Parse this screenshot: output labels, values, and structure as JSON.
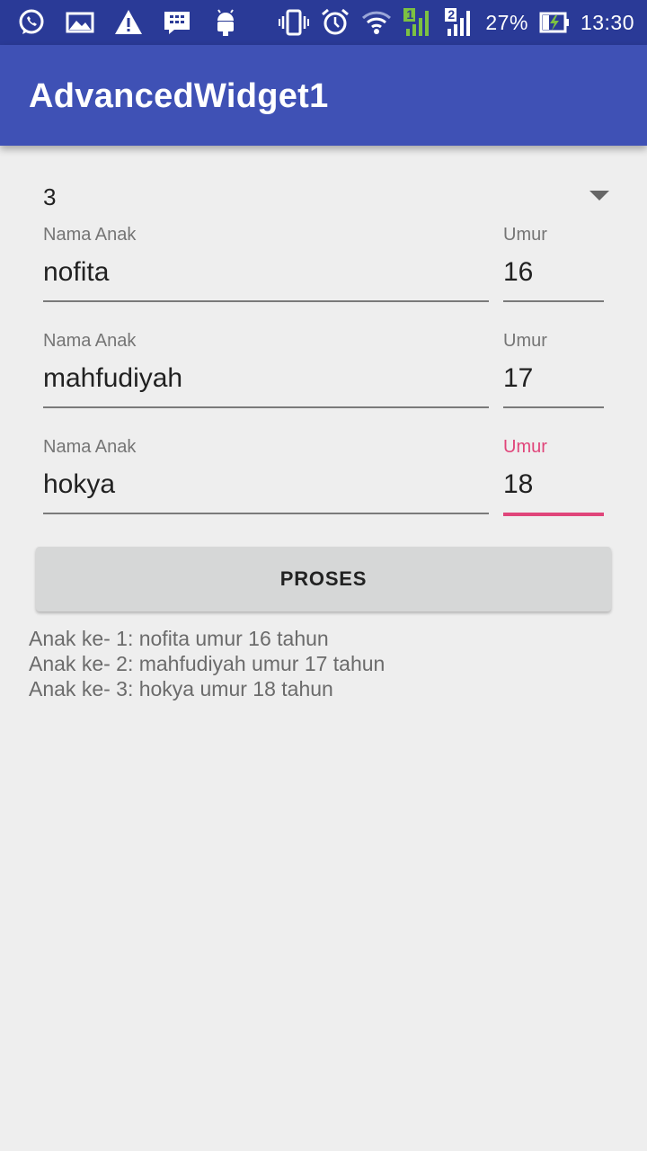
{
  "status_bar": {
    "battery_percent": "27%",
    "time": "13:30",
    "sim1_label": "1",
    "sim2_label": "2",
    "icons_left": [
      "whatsapp-icon",
      "gallery-icon",
      "warning-icon",
      "bbm-icon",
      "android-icon"
    ],
    "icons_right": [
      "vibrate-icon",
      "alarm-icon",
      "wifi-icon",
      "signal-sim1-icon",
      "signal-sim2-icon",
      "battery-charging-icon"
    ]
  },
  "app_bar": {
    "title": "AdvancedWidget1"
  },
  "spinner": {
    "selected": "3"
  },
  "rows": [
    {
      "name_label": "Nama Anak",
      "name_value": "nofita",
      "age_label": "Umur",
      "age_value": "16"
    },
    {
      "name_label": "Nama Anak",
      "name_value": "mahfudiyah",
      "age_label": "Umur",
      "age_value": "17"
    },
    {
      "name_label": "Nama Anak",
      "name_value": "hokya",
      "age_label": "Umur",
      "age_value": "18"
    }
  ],
  "button": {
    "label": "PROSES"
  },
  "results": [
    "Anak ke- 1: nofita umur 16 tahun",
    "Anak ke- 2: mahfudiyah umur 17 tahun",
    "Anak ke- 3: hokya umur 18 tahun"
  ],
  "colors": {
    "primary": "#3f51b5",
    "status_bar": "#2a3a97",
    "accent": "#e0457a",
    "background": "#eeeeee"
  }
}
